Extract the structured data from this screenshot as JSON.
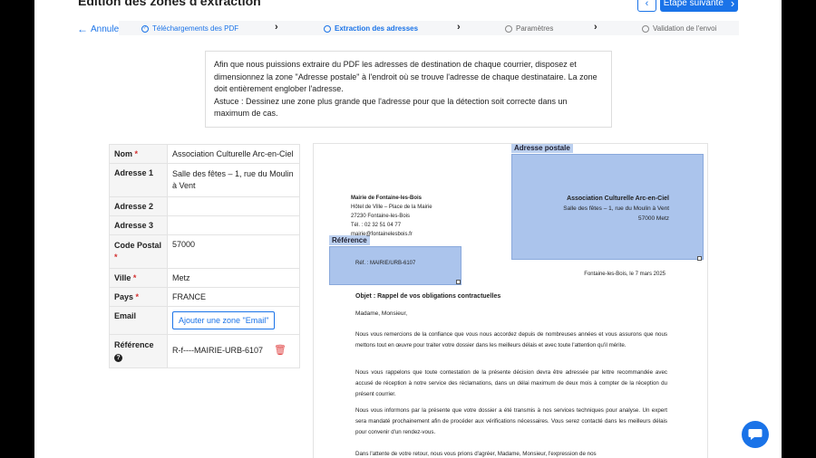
{
  "header": {
    "title": "Édition des zones d'extraction",
    "next_label": "Étape suivante",
    "back_label": "Annuler"
  },
  "steps": [
    {
      "label": "Téléchargements des PDF",
      "state": "done"
    },
    {
      "label": "Extraction des adresses",
      "state": "active"
    },
    {
      "label": "Paramètres",
      "state": "todo"
    },
    {
      "label": "Validation de l'envoi",
      "state": "todo"
    }
  ],
  "instructions": {
    "main": "Afin que nous puissions extraire du PDF les adresses de destination de chaque courrier, disposez et dimensionnez la zone \"Adresse postale\" à l'endroit où se trouve l'adresse de chaque destinataire. La zone doit entièrement englober l'adresse.",
    "tip": "Astuce : Dessinez une zone plus grande que l'adresse pour que la détection soit correcte dans un maximum de cas."
  },
  "fields": {
    "nom": {
      "label": "Nom",
      "value": "Association Culturelle Arc-en-Ciel"
    },
    "adresse1": {
      "label": "Adresse 1",
      "value": "Salle des fêtes – 1, rue du Moulin à Vent"
    },
    "adresse2": {
      "label": "Adresse 2",
      "value": ""
    },
    "adresse3": {
      "label": "Adresse 3",
      "value": ""
    },
    "code_postal": {
      "label": "Code Postal",
      "value": "57000"
    },
    "ville": {
      "label": "Ville",
      "value": "Metz"
    },
    "pays": {
      "label": "Pays",
      "value": "FRANCE"
    },
    "email": {
      "label": "Email",
      "button": "Ajouter une zone \"Email\""
    },
    "reference": {
      "label": "Référence",
      "value": "R-f----MAIRIE-URB-6107"
    },
    "required_mark": "*"
  },
  "document": {
    "zone_address_label": "Adresse postale",
    "zone_reference_label": "Référence",
    "sender": [
      "Mairie de Fontaine-les-Bois",
      "Hôtel de Ville – Place de la Mairie",
      "27230 Fontaine-les-Bois",
      "Tél. : 02 32 51 04 77",
      "mairie@fontainelesbois.fr"
    ],
    "recipient": [
      "Association Culturelle Arc-en-Ciel",
      "Salle des fêtes – 1, rue du Moulin à Vent",
      "57000 Metz"
    ],
    "ref_line": "Réf. : MAIRIE/URB-6107",
    "date_line": "Fontaine-les-Bois, le 7 mars 2025",
    "subject": "Objet : Rappel de vos obligations contractuelles",
    "greeting": "Madame, Monsieur,",
    "paragraphs": [
      "Nous vous remercions de la confiance que vous nous accordez depuis de nombreuses années et vous assurons que nous mettons tout en œuvre pour traiter votre dossier dans les meilleurs délais et avec toute l'attention qu'il mérite.",
      "Nous vous rappelons que toute contestation de la présente décision devra être adressée par lettre recommandée avec accusé de réception à notre service des réclamations, dans un délai maximum de deux mois à compter de la réception du présent courrier.",
      "Nous vous informons par la présente que votre dossier a été transmis à nos services techniques pour analyse. Un expert sera mandaté prochainement afin de procéder aux vérifications nécessaires. Vous serez contacté dans les meilleurs délais pour convenir d'un rendez-vous.",
      "Dans l'attente de votre retour, nous vous prions d'agréer, Madame, Monsieur, l'expression de nos"
    ]
  },
  "icons": {
    "prev": "chevron-left-icon",
    "next": "chevron-right-icon",
    "back": "arrow-left-icon",
    "trash": "trash-icon",
    "help": "question-circle-icon",
    "chat": "chat-icon"
  },
  "colors": {
    "accent": "#1a73e8",
    "zone": "#7aa0e1",
    "required": "#d32f2f",
    "trash": "#e04545"
  }
}
